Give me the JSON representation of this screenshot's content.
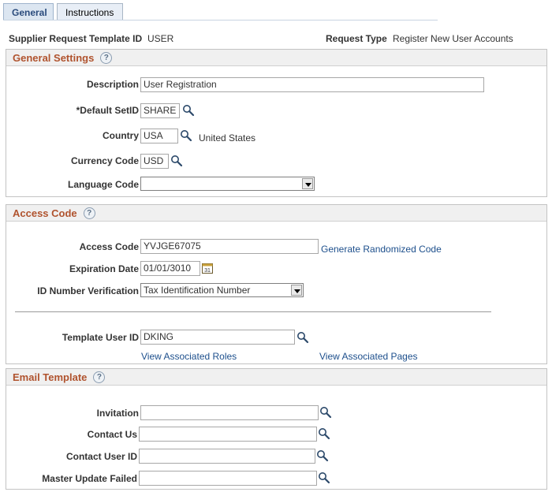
{
  "tabs": [
    {
      "label": "General",
      "active": true
    },
    {
      "label": "Instructions",
      "active": false
    }
  ],
  "header": {
    "template_id_label": "Supplier Request Template ID",
    "template_id_value": "USER",
    "request_type_label": "Request Type",
    "request_type_value": "Register New User Accounts"
  },
  "general_settings": {
    "title": "General Settings",
    "help": "?",
    "description_label": "Description",
    "description_value": "User Registration",
    "setid_label": "*Default SetID",
    "setid_value": "SHARE",
    "country_label": "Country",
    "country_value": "USA",
    "country_desc": "United States",
    "currency_label": "Currency Code",
    "currency_value": "USD",
    "language_label": "Language Code",
    "language_value": ""
  },
  "access_code": {
    "title": "Access Code",
    "help": "?",
    "access_code_label": "Access Code",
    "access_code_value": "YVJGE67075",
    "generate_link": "Generate Randomized Code",
    "expiration_label": "Expiration Date",
    "expiration_value": "01/01/3010",
    "calendar_glyph": "31",
    "id_verification_label": "ID Number Verification",
    "id_verification_value": "Tax Identification Number",
    "template_user_label": "Template User ID",
    "template_user_value": "DKING",
    "view_roles_link": "View Associated Roles",
    "view_pages_link": "View Associated Pages"
  },
  "email_template": {
    "title": "Email Template",
    "help": "?",
    "invitation_label": "Invitation",
    "invitation_value": "",
    "contact_us_label": "Contact Us",
    "contact_us_value": "",
    "contact_user_label": "Contact User ID",
    "contact_user_value": "",
    "master_update_label": "Master Update Failed",
    "master_update_value": ""
  },
  "icons": {
    "lookup": "magnifier-lookup-icon",
    "calendar": "calendar-icon",
    "help": "help-circle-icon"
  },
  "colors": {
    "section_title": "#b0532e",
    "link": "#1d4f8c",
    "tab_active_text": "#2a4b7c"
  }
}
